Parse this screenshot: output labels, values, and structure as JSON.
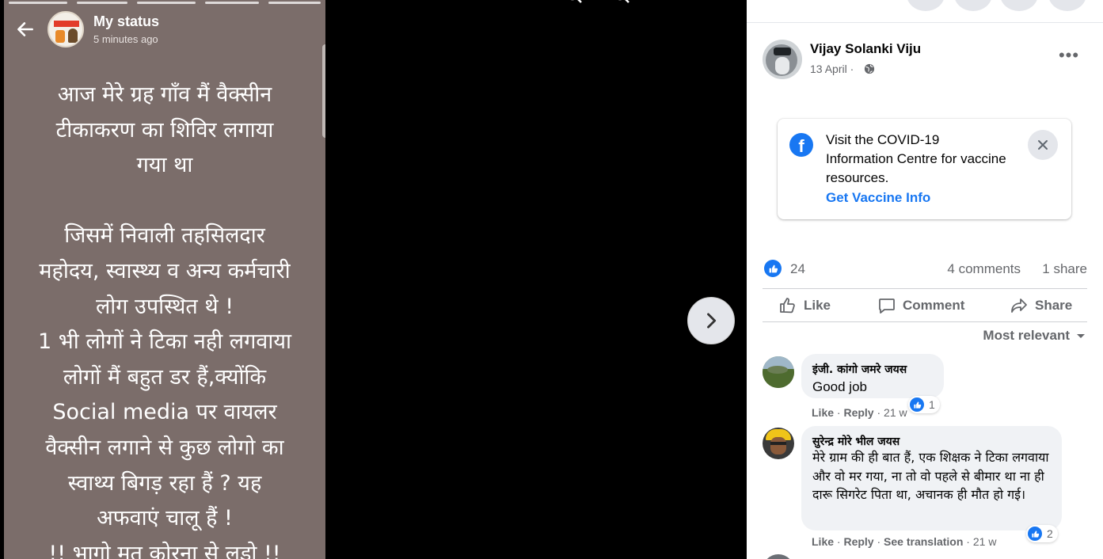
{
  "story": {
    "title": "My status",
    "time": "5 minutes ago",
    "text": "आज मेरे ग्रह गाँव मैं वैक्सीन\nटीकाकरण का शिविर लगाया\nगया था\n\nजिसमें निवाली तहसिलदार\nमहोदय, स्वास्थ्य व अन्य कर्मचारी\nलोग उपस्थित थे !\n1 भी लोगों ने टिका नही लगवाया\nलोगों मैं बहुत डर हैं,क्योंकि\nSocial media पर वायलर\nवैक्सीन लगाने से कुछ लोगो का\nस्वाथ्य बिगड़ रहा हैं ? यह\nअफवाएं चालू हैं !\n!! भागो मत कोरना से लड़ो !!"
  },
  "post": {
    "author": "Vijay Solanki Viju",
    "date": "13 April ·",
    "menu_label": "•••"
  },
  "covid_card": {
    "text": "Visit the COVID-19 Information Centre for vaccine resources.",
    "link": "Get Vaccine Info"
  },
  "stats": {
    "reactions": "24",
    "comments": "4 comments",
    "shares": "1 share"
  },
  "actions": {
    "like": "Like",
    "comment": "Comment",
    "share": "Share"
  },
  "sort_label": "Most relevant",
  "comments": [
    {
      "name": "इंजी. कांगो जमरे जयस",
      "text": "Good job",
      "reactions": "1",
      "like": "Like",
      "sep1": " · ",
      "reply": "Reply",
      "time": " · 21 w"
    },
    {
      "name": "सुरेन्द्र मोरे भील जयस",
      "text": "मेरे ग्राम की ही बात हैं, एक शिक्षक ने टिका लगवाया और वो मर गया, ना तो वो पहले से बीमार था ना ही दारू सिगरेट पिता था, अचानक ही मौत हो गई।",
      "reactions": "2",
      "like": "Like",
      "sep1": " · ",
      "reply": "Reply",
      "sep2": " · ",
      "translate": "See translation",
      "time": " · 21 w"
    }
  ],
  "colors": {
    "facebook_blue": "#1877f2",
    "story_bg": "#7b6d6a",
    "secondary_text": "#65676b"
  }
}
